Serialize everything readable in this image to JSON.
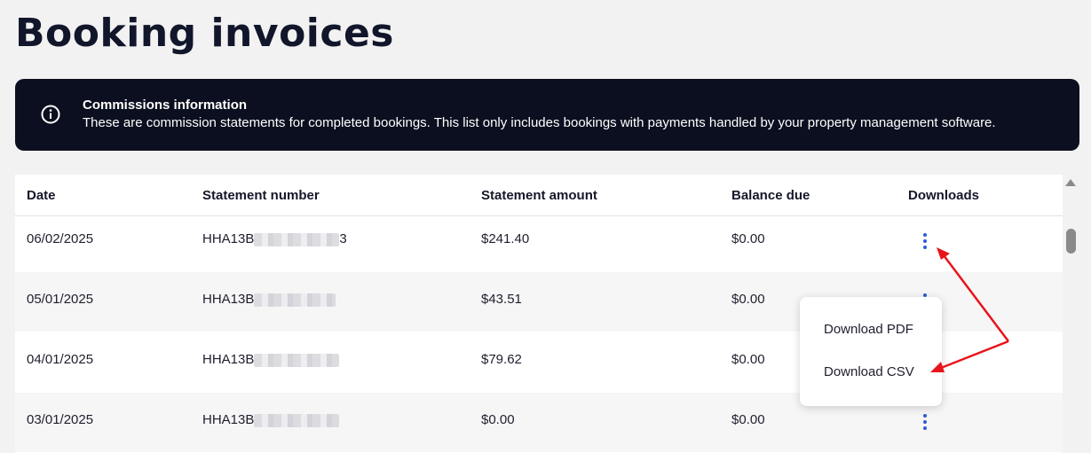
{
  "page": {
    "title": "Booking invoices"
  },
  "banner": {
    "icon": "info-icon",
    "title": "Commissions information",
    "text": "These are commission statements for completed bookings. This list only includes bookings with payments handled by your property management software."
  },
  "table": {
    "columns": [
      "Date",
      "Statement number",
      "Statement amount",
      "Balance due",
      "Downloads"
    ],
    "rows": [
      {
        "date": "06/02/2025",
        "statement_prefix": "HHA13B",
        "statement_suffix": "3",
        "amount": "$241.40",
        "balance": "$0.00"
      },
      {
        "date": "05/01/2025",
        "statement_prefix": "HHA13B",
        "statement_suffix": "",
        "amount": "$43.51",
        "balance": "$0.00"
      },
      {
        "date": "04/01/2025",
        "statement_prefix": "HHA13B",
        "statement_suffix": "",
        "amount": "$79.62",
        "balance": "$0.00"
      },
      {
        "date": "03/01/2025",
        "statement_prefix": "HHA13B",
        "statement_suffix": "",
        "amount": "$0.00",
        "balance": "$0.00"
      }
    ]
  },
  "menu": {
    "items": [
      "Download PDF",
      "Download CSV"
    ]
  },
  "colors": {
    "accent": "#2d5bd7",
    "banner_bg": "#0c0f1f",
    "annotation_arrow": "#e8141b"
  }
}
